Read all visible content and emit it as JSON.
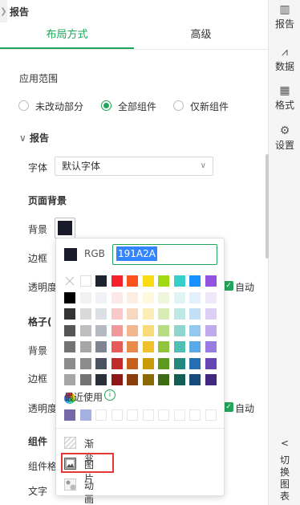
{
  "panel": {
    "title": "报告",
    "collapse_glyph": "❯"
  },
  "tabs": [
    {
      "label": "布局方式",
      "active": true
    },
    {
      "label": "高级",
      "active": false
    }
  ],
  "rail": {
    "items": [
      {
        "label": "报告",
        "icon": "report-icon",
        "glyph": "▥"
      },
      {
        "label": "数据",
        "icon": "data-icon",
        "glyph": "⩘"
      },
      {
        "label": "格式",
        "icon": "format-icon",
        "glyph": "▦"
      },
      {
        "label": "设置",
        "icon": "gear-icon",
        "glyph": "⚙"
      }
    ],
    "switch": {
      "glyph": "<",
      "chars": [
        "切",
        "换",
        "图",
        "表"
      ]
    }
  },
  "scope": {
    "label": "应用范围",
    "options": [
      "未改动部分",
      "全部组件",
      "仅新组件"
    ],
    "selected": "全部组件"
  },
  "report_section": {
    "title": "报告",
    "chevron": "∨",
    "font_label": "字体",
    "font_value": "默认字体",
    "page_bg": {
      "title": "页面背景",
      "bg_label": "背景",
      "border_label": "边框",
      "opacity_label": "透明度",
      "auto_label": "自动"
    },
    "grid_section": {
      "title": "格子(",
      "bg_label": "背景",
      "border_label": "边框",
      "opacity_label": "透明度",
      "auto_label": "自动"
    },
    "component": {
      "title": "组件",
      "style_label": "组件格",
      "text_label": "文字"
    }
  },
  "color_picker": {
    "current_color": "#191A2A",
    "mode_label": "RGB",
    "hex_value": "191A2A",
    "recent_label": "最近使用",
    "info_glyph": "i",
    "palette_rows": [
      [
        "none",
        "#ffffff",
        "#1d2430",
        "#f5222d",
        "#fa541c",
        "#fadb14",
        "#a0d911",
        "#36cfc9",
        "#1890ff",
        "#9254de"
      ],
      [
        "#000000",
        "#f2f2f2",
        "#f0f2f5",
        "#fde8e8",
        "#fdeee3",
        "#fef8dc",
        "#eef7dc",
        "#e0f5f3",
        "#e3f0fb",
        "#efe8fb"
      ],
      [
        "#333333",
        "#d9d9d9",
        "#dcdfe4",
        "#f8c9c9",
        "#f8d7bf",
        "#fcedb6",
        "#d8edb6",
        "#bfe8e4",
        "#c2dff6",
        "#dccef5"
      ],
      [
        "#555555",
        "#bfbfbf",
        "#b4b9c2",
        "#f19999",
        "#f2b78e",
        "#f8dc7a",
        "#b8dc82",
        "#8fd6cf",
        "#94c8ef",
        "#bfaaee"
      ],
      [
        "#737373",
        "#a6a6a6",
        "#7e8694",
        "#e85a5a",
        "#ea8a4a",
        "#f2c02c",
        "#8fc63d",
        "#4fbfb4",
        "#5aa8e6",
        "#9a7ce0"
      ],
      [
        "#8c8c8c",
        "#8c8c8c",
        "#4a5262",
        "#c12a2a",
        "#c7601c",
        "#c99a0a",
        "#5e9a1f",
        "#23897f",
        "#266fb3",
        "#6646b5"
      ],
      [
        "#a6a6a6",
        "#737373",
        "#2a2f3a",
        "#8e1818",
        "#8a3e0c",
        "#8a6a05",
        "#3d6a12",
        "#145e56",
        "#174b7d",
        "#42287e"
      ]
    ],
    "recent_colors": [
      "#7569a8",
      "#a5b1e0",
      "",
      "",
      "",
      "",
      "",
      "",
      "",
      ""
    ],
    "options": [
      {
        "label": "渐变",
        "icon": "gradient-icon"
      },
      {
        "label": "图片",
        "icon": "image-icon",
        "highlighted": true
      },
      {
        "label": "动画",
        "icon": "animation-icon"
      }
    ]
  }
}
